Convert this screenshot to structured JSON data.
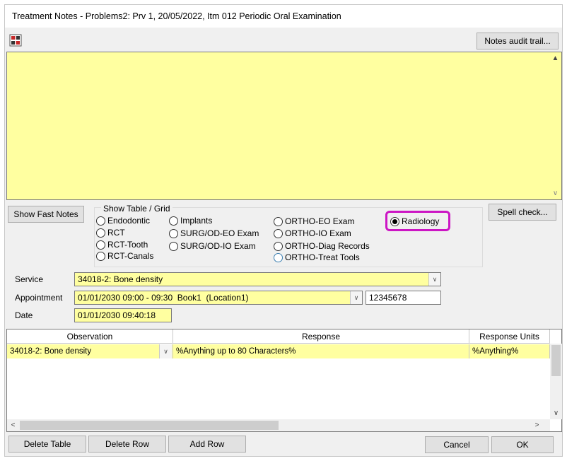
{
  "window": {
    "title": "Treatment Notes - Problems2: Prv 1, 20/05/2022, Itm 012 Periodic Oral Examination"
  },
  "toolbar": {
    "notes_audit_label": "Notes audit trail..."
  },
  "notes": {
    "value": ""
  },
  "buttons": {
    "show_fast_notes": "Show Fast Notes",
    "spell_check": "Spell check...",
    "delete_table": "Delete Table",
    "delete_row": "Delete Row",
    "add_row": "Add Row",
    "cancel": "Cancel",
    "ok": "OK"
  },
  "show_table_grid": {
    "title": "Show Table / Grid",
    "options": [
      {
        "label": "Endodontic",
        "selected": false
      },
      {
        "label": "RCT",
        "selected": false
      },
      {
        "label": "RCT-Tooth",
        "selected": false
      },
      {
        "label": "RCT-Canals",
        "selected": false
      },
      {
        "label": "Implants",
        "selected": false
      },
      {
        "label": "SURG/OD-EO Exam",
        "selected": false
      },
      {
        "label": "SURG/OD-IO Exam",
        "selected": false
      },
      {
        "label": "ORTHO-EO Exam",
        "selected": false
      },
      {
        "label": "ORTHO-IO Exam",
        "selected": false
      },
      {
        "label": "ORTHO-Diag Records",
        "selected": false
      },
      {
        "label": "ORTHO-Treat Tools",
        "selected": false
      },
      {
        "label": "Radiology",
        "selected": true
      }
    ],
    "highlight_color": "#cc16c4"
  },
  "form": {
    "service_label": "Service",
    "service_value": "34018-2: Bone density",
    "appointment_label": "Appointment",
    "appointment_value": "01/01/2030 09:00 - 09:30  Book1  (Location1)",
    "appointment_id": "12345678",
    "date_label": "Date",
    "date_value": "01/01/2030 09:40:18"
  },
  "grid": {
    "columns": [
      "Observation",
      "Response",
      "Response Units"
    ],
    "rows": [
      {
        "observation": "34018-2: Bone density",
        "response": "%Anything up to 80 Characters%",
        "units": "%Anything%"
      }
    ]
  },
  "colors": {
    "field_yellow": "#ffffa0",
    "window_bg": "#f0f0f0"
  }
}
